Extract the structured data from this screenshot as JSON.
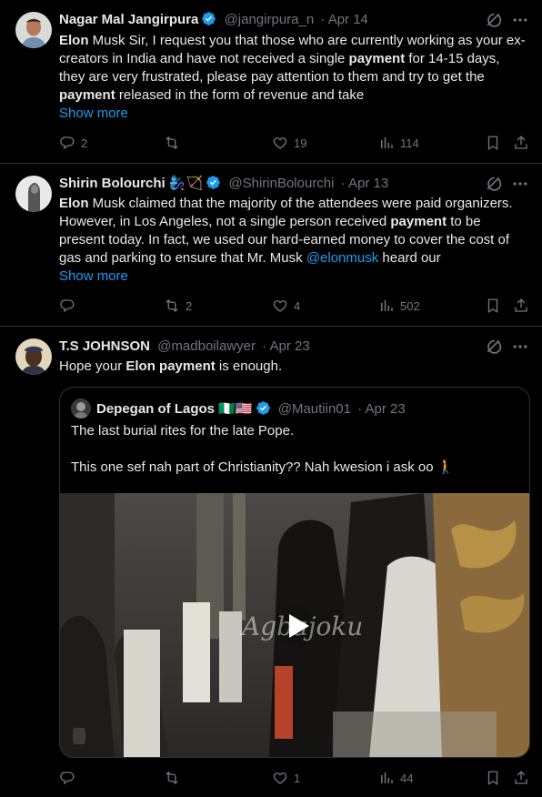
{
  "tweets": [
    {
      "name": "Nagar Mal Jangirpura",
      "handle": "@jangirpura_n",
      "date": "· Apr 14",
      "text_parts": [
        {
          "t": "Elon",
          "b": true
        },
        {
          "t": " Musk Sir, I request you that those who are currently working as your ex-creators in India and have not received a single ",
          "b": false
        },
        {
          "t": "payment",
          "b": true
        },
        {
          "t": " for 14-15 days, they are very frustrated, please pay attention to them and try to get the ",
          "b": false
        },
        {
          "t": "payment",
          "b": true
        },
        {
          "t": " released in the form of revenue and take",
          "b": false
        }
      ],
      "show_more": "Show more",
      "replies": "2",
      "reposts": "",
      "likes": "19",
      "views": "114"
    },
    {
      "name": "Shirin Bolourchi",
      "name_emoji": "🧞‍♀️🏹",
      "handle": "@ShirinBolourchi",
      "date": "· Apr 13",
      "text_parts": [
        {
          "t": "Elon",
          "b": true
        },
        {
          "t": " Musk claimed that the majority of the attendees were paid organizers. However, in Los Angeles, not a single person received ",
          "b": false
        },
        {
          "t": "payment",
          "b": true
        },
        {
          "t": " to be present today. In fact, we used our hard-earned money to cover the cost of gas and parking to ensure that Mr. Musk ",
          "b": false
        },
        {
          "t": "@elonmusk",
          "link": true
        },
        {
          "t": " heard our",
          "b": false
        }
      ],
      "show_more": "Show more",
      "replies": "",
      "reposts": "2",
      "likes": "4",
      "views": "502"
    },
    {
      "name": "T.S JOHNSON",
      "handle": "@madboilawyer",
      "date": "· Apr 23",
      "text_parts": [
        {
          "t": "Hope your ",
          "b": false
        },
        {
          "t": "Elon payment",
          "b": true
        },
        {
          "t": " is enough.",
          "b": false
        }
      ],
      "replies": "",
      "reposts": "",
      "likes": "1",
      "views": "44",
      "quote": {
        "name": "Depegan of Lagos",
        "flags": "🇳🇬🇺🇸",
        "handle": "@Mautiin01",
        "date": "· Apr 23",
        "line1": "The last burial rites for the late Pope.",
        "line2": "This one sef nah part of Christianity?? Nah kwesion i ask oo 🚶",
        "watermark": "Agbajoku"
      }
    }
  ],
  "colors": {
    "background": "#000000",
    "text": "#e7e9ea",
    "muted": "#71767b",
    "link": "#1d9bf0",
    "border": "#2f3336",
    "verified": "#1d9bf0"
  },
  "icons": [
    "verified-badge-icon",
    "grok-icon",
    "more-icon",
    "reply-icon",
    "repost-icon",
    "like-icon",
    "views-icon",
    "bookmark-icon",
    "share-icon",
    "play-icon"
  ]
}
